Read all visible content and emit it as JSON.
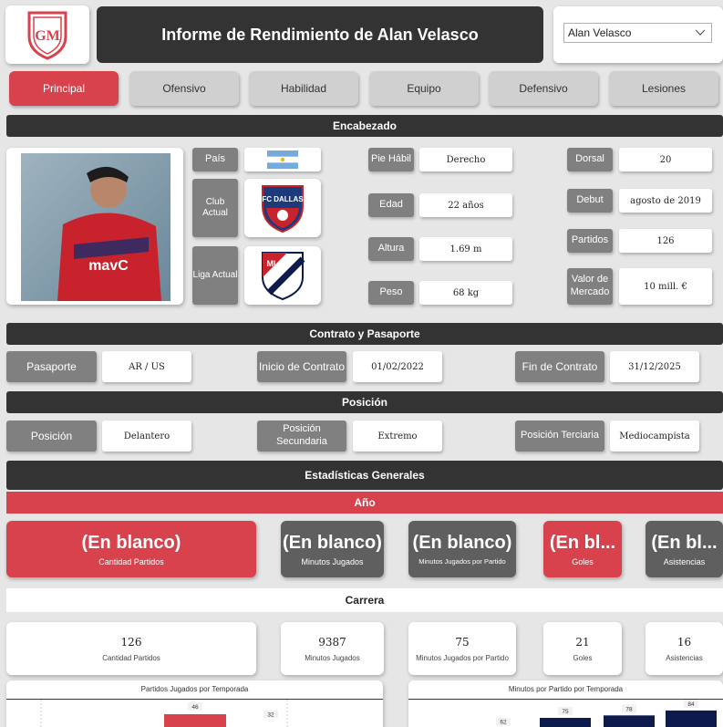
{
  "header": {
    "logo_text": "GM",
    "title": "Informe de Rendimiento de Alan Velasco",
    "player_select": {
      "value": "Alan Velasco"
    }
  },
  "tabs": [
    {
      "label": "Principal",
      "active": true
    },
    {
      "label": "Ofensivo",
      "active": false
    },
    {
      "label": "Habilidad",
      "active": false
    },
    {
      "label": "Equipo",
      "active": false
    },
    {
      "label": "Defensivo",
      "active": false
    },
    {
      "label": "Lesiones",
      "active": false
    }
  ],
  "encabezado": {
    "section_title": "Encabezado",
    "pais_label": "País",
    "club_label": "Club Actual",
    "liga_label": "Liga Actual",
    "club_logo_text": "FC DALLAS",
    "liga_logo_text": "MLS",
    "pie_label": "Pie Hábil",
    "pie_value": "Derecho",
    "edad_label": "Edad",
    "edad_value": "22 años",
    "altura_label": "Altura",
    "altura_value": "1.69 m",
    "peso_label": "Peso",
    "peso_value": "68 kg",
    "dorsal_label": "Dorsal",
    "dorsal_value": "20",
    "debut_label": "Debut",
    "debut_value": "agosto de 2019",
    "partidos_label": "Partidos",
    "partidos_value": "126",
    "valor_label": "Valor de Mercado",
    "valor_value": "10 mill. €"
  },
  "contrato": {
    "section_title": "Contrato y Pasaporte",
    "pasaporte_label": "Pasaporte",
    "pasaporte_value": "AR / US",
    "inicio_label": "Inicio de Contrato",
    "inicio_value": "01/02/2022",
    "fin_label": "Fin de Contrato",
    "fin_value": "31/12/2025"
  },
  "posicion": {
    "section_title": "Posición",
    "pos1_label": "Posición",
    "pos1_value": "Delantero",
    "pos2_label": "Posición Secundaria",
    "pos2_value": "Extremo",
    "pos3_label": "Posición Terciaria",
    "pos3_value": "Mediocampista"
  },
  "estadisticas": {
    "section_title": "Estadísticas Generales",
    "year_bar": "Año",
    "kpis": [
      {
        "value": "(En blanco)",
        "caption": "Cantidad Partidos"
      },
      {
        "value": "(En blanco)",
        "caption": "Minutos Jugados"
      },
      {
        "value": "(En blanco)",
        "caption": "Minutos Jugados por Partido"
      },
      {
        "value": "(En bl...",
        "caption": "Goles"
      },
      {
        "value": "(En bl...",
        "caption": "Asistencias"
      }
    ],
    "carrera_title": "Carrera",
    "carrera": [
      {
        "value": "126",
        "caption": "Cantidad Partidos"
      },
      {
        "value": "9387",
        "caption": "Minutos Jugados"
      },
      {
        "value": "75",
        "caption": "Minutos Jugados por Partido"
      },
      {
        "value": "21",
        "caption": "Goles"
      },
      {
        "value": "16",
        "caption": "Asistencias"
      }
    ]
  },
  "colors": {
    "accent_red": "#d7424d",
    "dark": "#333333",
    "label_gray": "#808080",
    "navy": "#0d1b4c"
  },
  "chart_data": [
    {
      "type": "bar",
      "title": "Partidos Jugados por Temporada",
      "data_labels": [
        "46",
        "32"
      ],
      "values": [
        46,
        32
      ]
    },
    {
      "type": "bar",
      "title": "Minutos por Partido por Temporada",
      "data_labels": [
        "62",
        "75",
        "78",
        "84"
      ],
      "values": [
        62,
        75,
        78,
        84
      ]
    }
  ]
}
